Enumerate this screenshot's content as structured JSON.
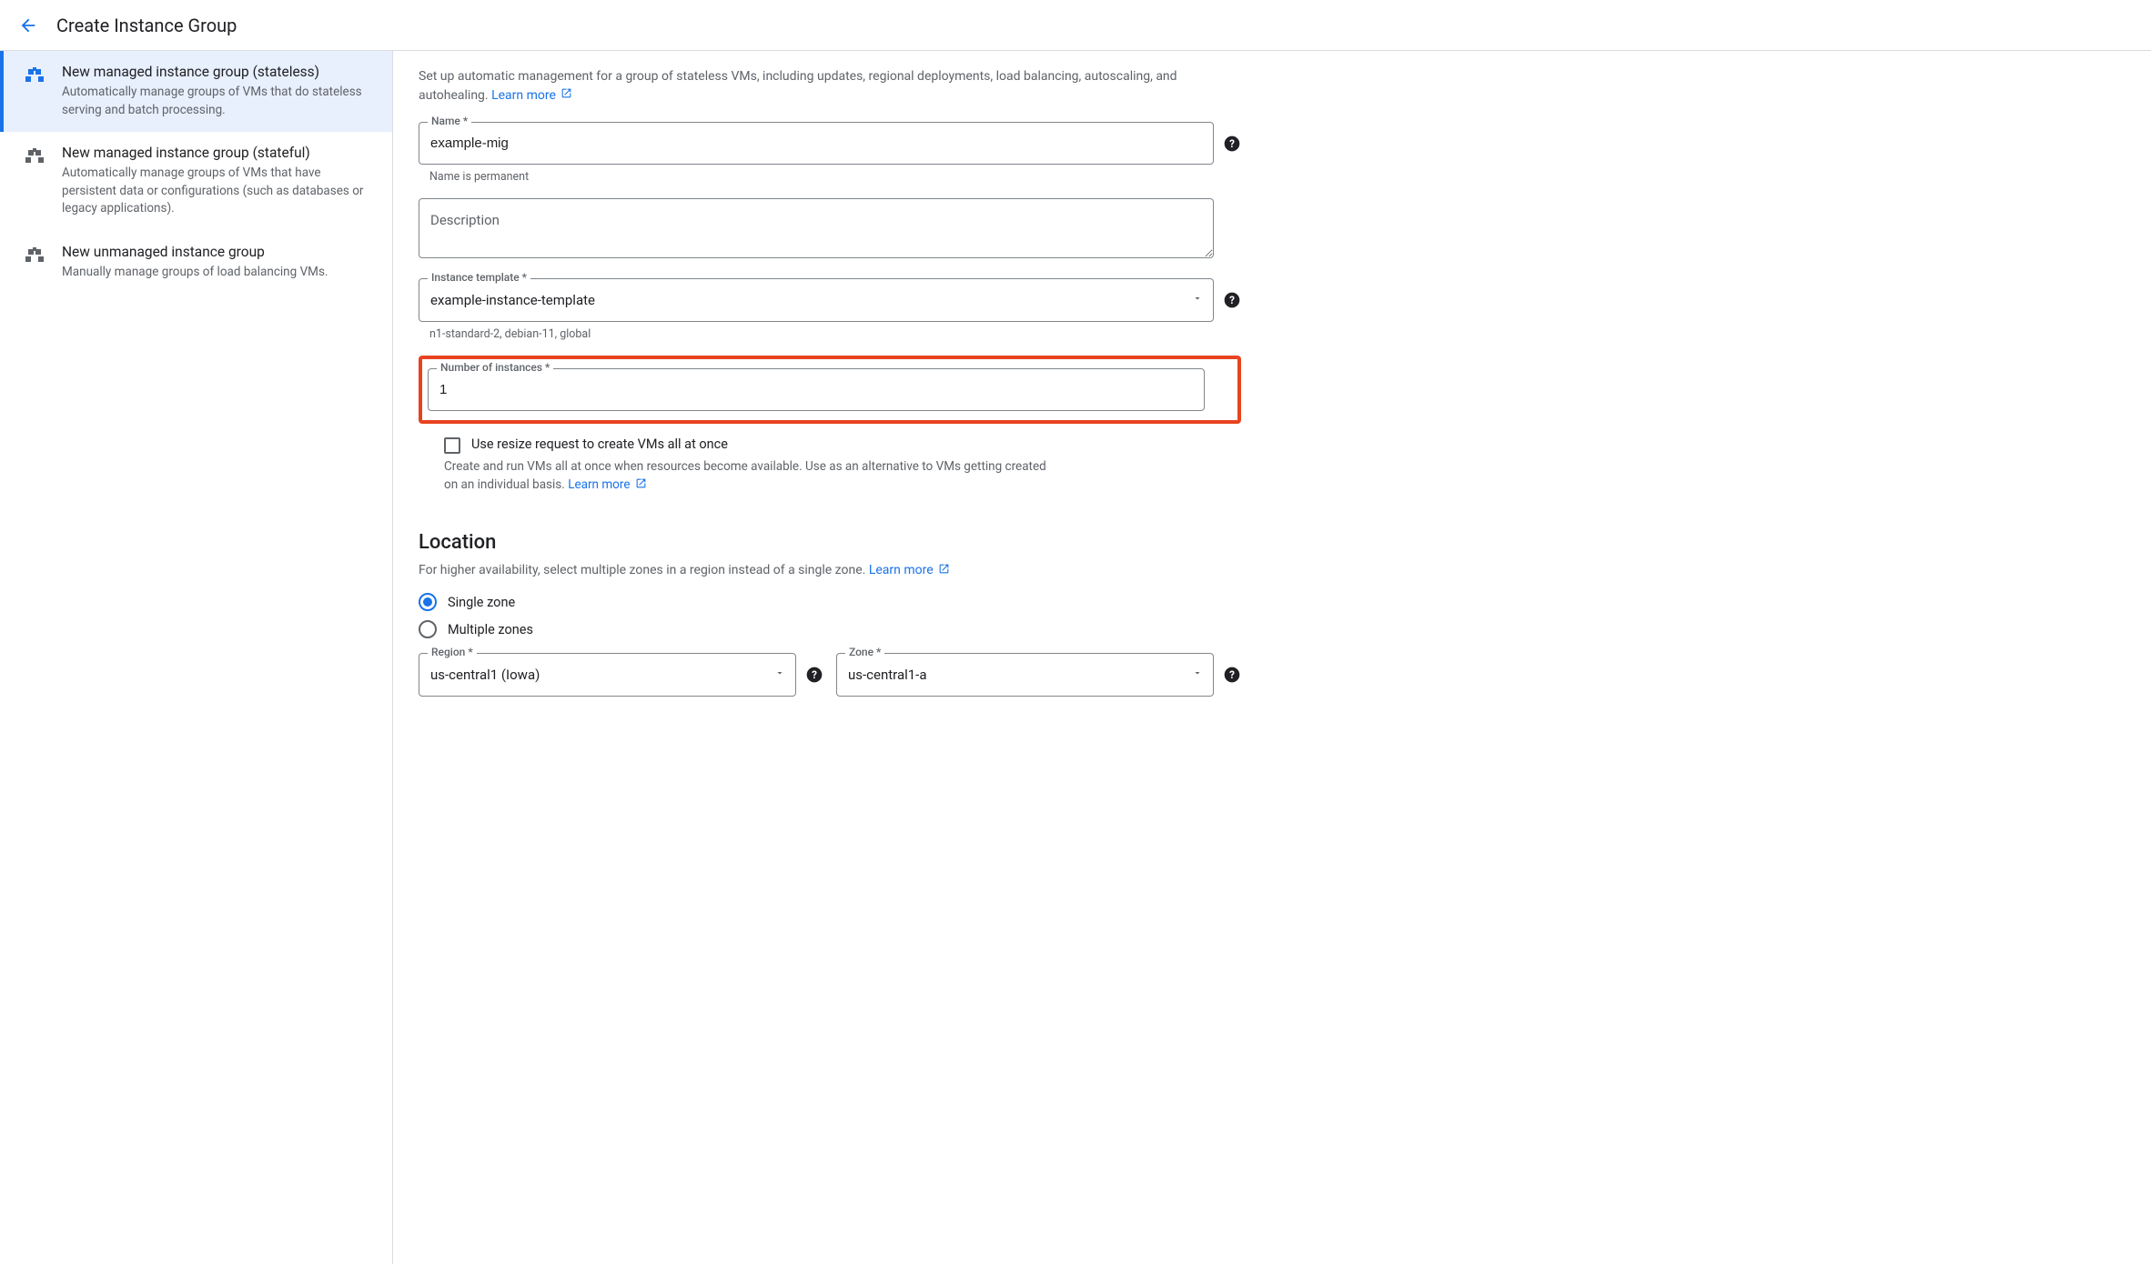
{
  "header": {
    "title": "Create Instance Group"
  },
  "sidebar": {
    "items": [
      {
        "title": "New managed instance group (stateless)",
        "desc": "Automatically manage groups of VMs that do stateless serving and batch processing."
      },
      {
        "title": "New managed instance group (stateful)",
        "desc": "Automatically manage groups of VMs that have persistent data or configurations (such as databases or legacy applications)."
      },
      {
        "title": "New unmanaged instance group",
        "desc": "Manually manage groups of load balancing VMs."
      }
    ]
  },
  "main": {
    "intro": "Set up automatic management for a group of stateless VMs, including updates, regional deployments, load balancing, autoscaling, and autohealing. ",
    "learn_more": "Learn more",
    "name": {
      "label": "Name *",
      "value": "example-mig",
      "hint": "Name is permanent"
    },
    "description": {
      "placeholder": "Description",
      "value": ""
    },
    "template": {
      "label": "Instance template *",
      "value": "example-instance-template",
      "hint": "n1-standard-2, debian-11, global"
    },
    "num_instances": {
      "label": "Number of instances *",
      "value": "1"
    },
    "resize": {
      "label": "Use resize request to create VMs all at once",
      "desc": "Create and run VMs all at once when resources become available. Use as an alternative to VMs getting created on an individual basis. "
    },
    "location": {
      "title": "Location",
      "desc": "For higher availability, select multiple zones in a region instead of a single zone. ",
      "single": "Single zone",
      "multiple": "Multiple zones",
      "region": {
        "label": "Region *",
        "value": "us-central1 (Iowa)"
      },
      "zone": {
        "label": "Zone *",
        "value": "us-central1-a"
      }
    }
  }
}
